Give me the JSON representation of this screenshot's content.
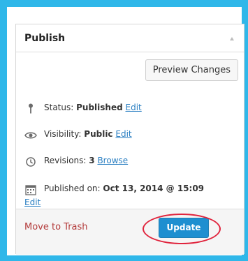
{
  "panel": {
    "title": "Publish",
    "preview_label": "Preview Changes"
  },
  "status": {
    "label": "Status: ",
    "value": "Published",
    "link": "Edit",
    "icon": "pin-icon"
  },
  "visibility": {
    "label": "Visibility: ",
    "value": "Public",
    "link": "Edit",
    "icon": "eye-icon"
  },
  "revisions": {
    "label": "Revisions: ",
    "value": "3",
    "link": "Browse",
    "icon": "history-icon"
  },
  "published": {
    "label": "Published on: ",
    "value": "Oct 13, 2014 @ 15:09",
    "link": "Edit",
    "icon": "calendar-icon"
  },
  "footer": {
    "trash_label": "Move to Trash",
    "update_label": "Update"
  },
  "colors": {
    "background": "#2fb7e9",
    "link": "#2a7fc2",
    "trash": "#b33b3b",
    "update": "#1e8fd0",
    "highlight": "#e0243d"
  }
}
